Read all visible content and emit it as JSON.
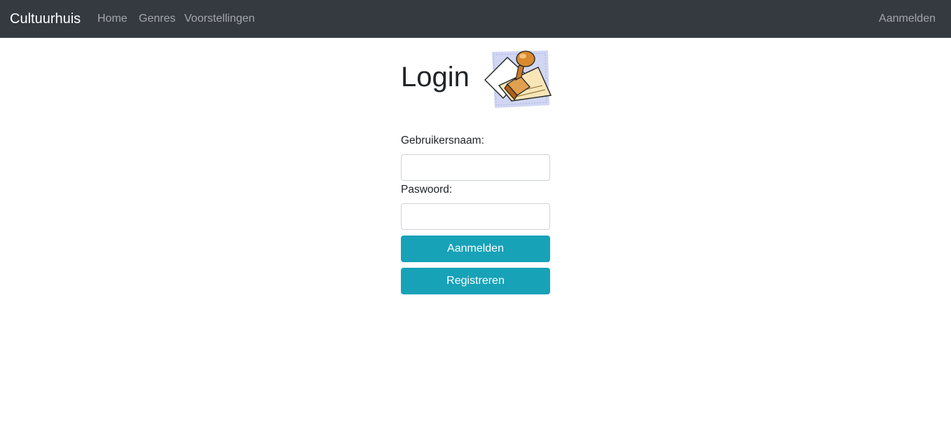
{
  "navbar": {
    "brand": "Cultuurhuis",
    "links": [
      {
        "label": "Home"
      },
      {
        "label": "Genres"
      },
      {
        "label": "Voorstellingen"
      }
    ],
    "login_link": "Aanmelden"
  },
  "main": {
    "title": "Login",
    "image_icon": "rubber-stamp-clipart",
    "form": {
      "username_label": "Gebruikersnaam:",
      "username_value": "",
      "password_label": "Paswoord:",
      "password_value": "",
      "login_button": "Aanmelden",
      "register_button": "Registreren"
    }
  },
  "colors": {
    "navbar_bg": "#343a40",
    "button_accent": "#17a2b8"
  }
}
